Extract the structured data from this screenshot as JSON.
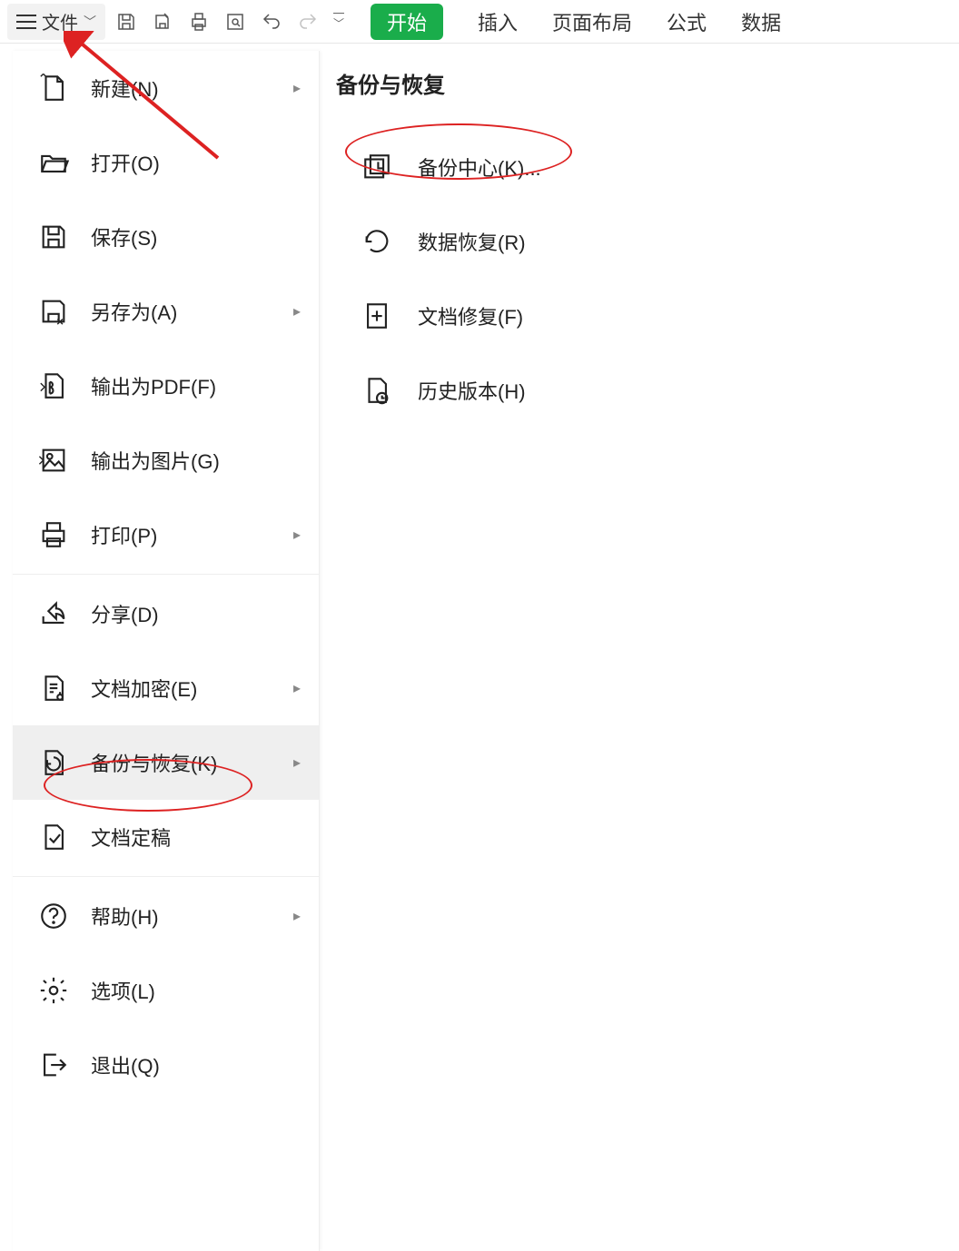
{
  "toolbar": {
    "file_label": "文件"
  },
  "tabs": {
    "start": "开始",
    "insert": "插入",
    "layout": "页面布局",
    "formula": "公式",
    "data": "数据"
  },
  "filemenu": {
    "new": "新建(N)",
    "open": "打开(O)",
    "save": "保存(S)",
    "saveas": "另存为(A)",
    "exportpdf": "输出为PDF(F)",
    "exportimg": "输出为图片(G)",
    "print": "打印(P)",
    "share": "分享(D)",
    "encrypt": "文档加密(E)",
    "backup": "备份与恢复(K)",
    "final": "文档定稿",
    "help": "帮助(H)",
    "options": "选项(L)",
    "exit": "退出(Q)"
  },
  "subpanel": {
    "title": "备份与恢复",
    "backup_center": "备份中心(K)...",
    "data_recover": "数据恢复(R)",
    "doc_repair": "文档修复(F)",
    "history": "历史版本(H)"
  }
}
